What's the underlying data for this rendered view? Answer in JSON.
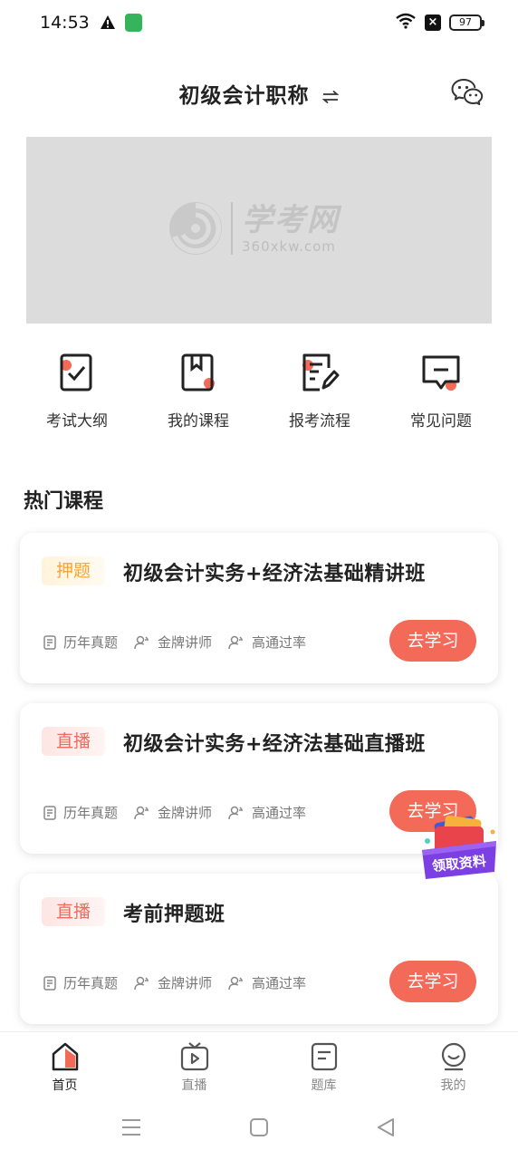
{
  "status_bar": {
    "time": "14:53",
    "battery": "97"
  },
  "header": {
    "title": "初级会计职称"
  },
  "banner": {
    "logo_cn": "学考网",
    "logo_en": "360xkw.com"
  },
  "quick_nav": [
    {
      "label": "考试大纲",
      "icon": "syllabus-checklist-icon"
    },
    {
      "label": "我的课程",
      "icon": "bookmark-book-icon"
    },
    {
      "label": "报考流程",
      "icon": "edit-document-icon"
    },
    {
      "label": "常见问题",
      "icon": "message-question-icon"
    }
  ],
  "section": {
    "title": "热门课程"
  },
  "courses": [
    {
      "badge": "押题",
      "title": "初级会计实务+经济法基础精讲班",
      "tags": [
        "历年真题",
        "金牌讲师",
        "高通过率"
      ],
      "button": "去学习"
    },
    {
      "badge": "直播",
      "title": "初级会计实务+经济法基础直播班",
      "tags": [
        "历年真题",
        "金牌讲师",
        "高通过率"
      ],
      "button": "去学习"
    },
    {
      "badge": "直播",
      "title": "考前押题班",
      "tags": [
        "历年真题",
        "金牌讲师",
        "高通过率"
      ],
      "button": "去学习"
    }
  ],
  "floating_promo": {
    "label": "领取资料"
  },
  "tab_bar": [
    {
      "label": "首页",
      "active": true
    },
    {
      "label": "直播",
      "active": false
    },
    {
      "label": "题库",
      "active": false
    },
    {
      "label": "我的",
      "active": false
    }
  ],
  "colors": {
    "accent": "#f36a59",
    "badge_ya": "#f3a53c",
    "badge_zb": "#ee6b5d"
  }
}
